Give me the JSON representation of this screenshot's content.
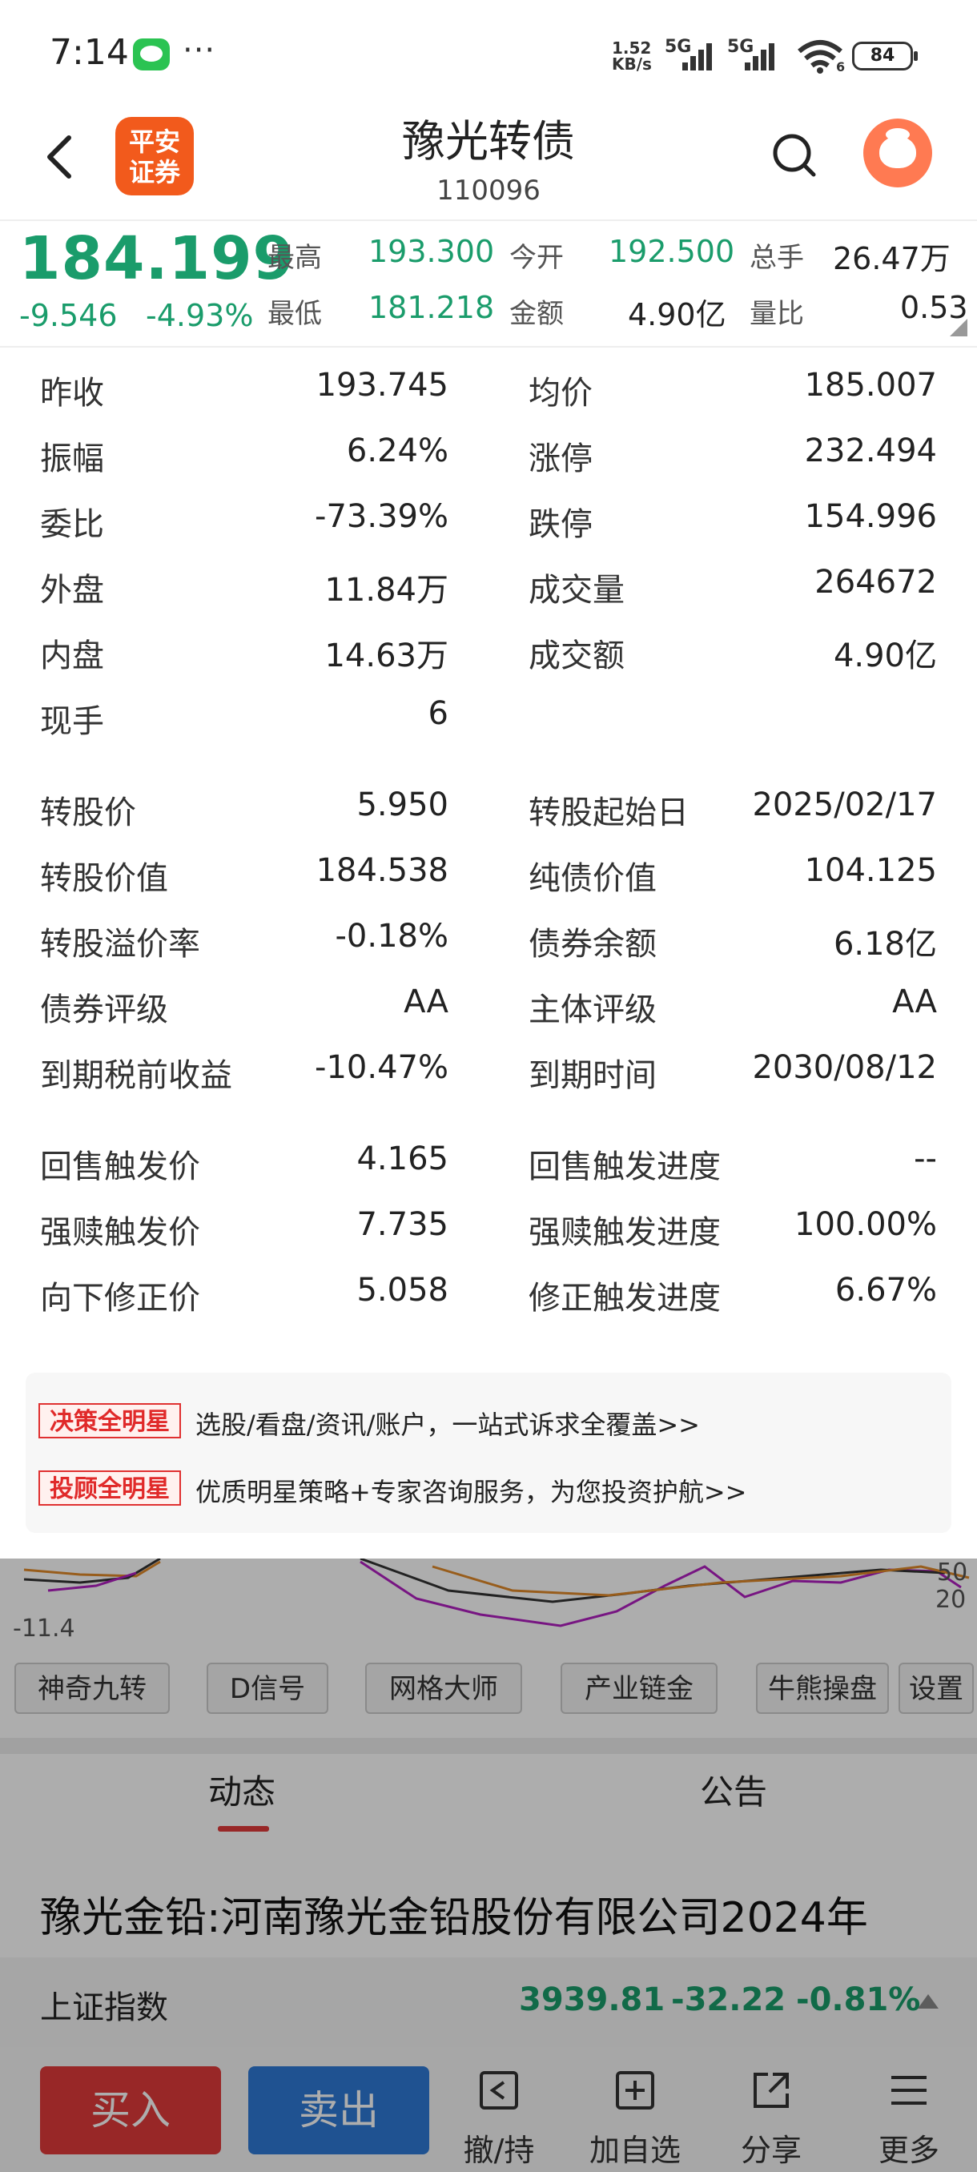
{
  "status_bar": {
    "time": "7:14",
    "net_speed": "1.52",
    "net_unit": "KB/s",
    "sim1": "5G",
    "sim2": "5G",
    "wifi_badge": "6",
    "battery": "84"
  },
  "header": {
    "logo_line1": "平安",
    "logo_line2": "证券",
    "title": "豫光转债",
    "code": "110096"
  },
  "quote": {
    "price": "184.199",
    "change": "-9.546",
    "change_pct": "-4.93%",
    "stats": [
      {
        "label": "最高",
        "value": "193.300",
        "color": "green"
      },
      {
        "label": "今开",
        "value": "192.500",
        "color": "green"
      },
      {
        "label": "总手",
        "value": "26.47万",
        "color": "black"
      },
      {
        "label": "最低",
        "value": "181.218",
        "color": "green"
      },
      {
        "label": "金额",
        "value": "4.90亿",
        "color": "black"
      },
      {
        "label": "量比",
        "value": "0.53",
        "color": "black"
      }
    ]
  },
  "details": {
    "group1_left": [
      {
        "label": "昨收",
        "value": "193.745",
        "color": "black"
      },
      {
        "label": "振幅",
        "value": "6.24%",
        "color": "black"
      },
      {
        "label": "委比",
        "value": "-73.39%",
        "color": "green"
      },
      {
        "label": "外盘",
        "value": "11.84万",
        "color": "red"
      },
      {
        "label": "内盘",
        "value": "14.63万",
        "color": "green"
      },
      {
        "label": "现手",
        "value": "6",
        "color": "black"
      }
    ],
    "group1_right": [
      {
        "label": "均价",
        "value": "185.007",
        "color": "green"
      },
      {
        "label": "涨停",
        "value": "232.494",
        "color": "red"
      },
      {
        "label": "跌停",
        "value": "154.996",
        "color": "green"
      },
      {
        "label": "成交量",
        "value": "264672",
        "color": "black"
      },
      {
        "label": "成交额",
        "value": "4.90亿",
        "color": "black"
      }
    ],
    "group2_left": [
      {
        "label": "转股价",
        "value": "5.950"
      },
      {
        "label": "转股价值",
        "value": "184.538"
      },
      {
        "label": "转股溢价率",
        "value": "-0.18%"
      },
      {
        "label": "债券评级",
        "value": "AA"
      },
      {
        "label": "到期税前收益",
        "value": "-10.47%"
      }
    ],
    "group2_right": [
      {
        "label": "转股起始日",
        "value": "2025/02/17"
      },
      {
        "label": "纯债价值",
        "value": "104.125"
      },
      {
        "label": "债券余额",
        "value": "6.18亿"
      },
      {
        "label": "主体评级",
        "value": "AA"
      },
      {
        "label": "到期时间",
        "value": "2030/08/12"
      }
    ],
    "group3_left": [
      {
        "label": "回售触发价",
        "value": "4.165"
      },
      {
        "label": "强赎触发价",
        "value": "7.735"
      },
      {
        "label": "向下修正价",
        "value": "5.058"
      }
    ],
    "group3_right": [
      {
        "label": "回售触发进度",
        "value": "--"
      },
      {
        "label": "强赎触发进度",
        "value": "100.00%"
      },
      {
        "label": "修正触发进度",
        "value": "6.67%"
      }
    ]
  },
  "ads": [
    {
      "tag": "决策全明星",
      "text": "选股/看盘/资讯/账户，一站式诉求全覆盖>>"
    },
    {
      "tag": "投顾全明星",
      "text": "优质明星策略+专家咨询服务，为您投资护航>>"
    }
  ],
  "chart": {
    "axis_left": "-11.4",
    "axis_right_top": "50",
    "axis_right_bottom": "20"
  },
  "indicator_chips": [
    "神奇九转",
    "D信号",
    "网格大师",
    "产业链金",
    "牛熊操盘",
    "设置"
  ],
  "content_tabs": {
    "news": "动态",
    "announcement": "公告"
  },
  "news_headline": "豫光金铅:河南豫光金铅股份有限公司2024年",
  "index_bar": {
    "name": "上证指数",
    "value": "3939.81",
    "change": "-32.22",
    "change_pct": "-0.81%"
  },
  "bottom_bar": {
    "buy": "买入",
    "sell": "卖出",
    "tools": [
      "撤/持",
      "加自选",
      "分享",
      "更多"
    ]
  },
  "colors": {
    "green": "#1a9c6b",
    "red": "#e02a2a",
    "brand": "#f25a1c",
    "buy": "#e03a3a",
    "sell": "#2f7ad6"
  }
}
